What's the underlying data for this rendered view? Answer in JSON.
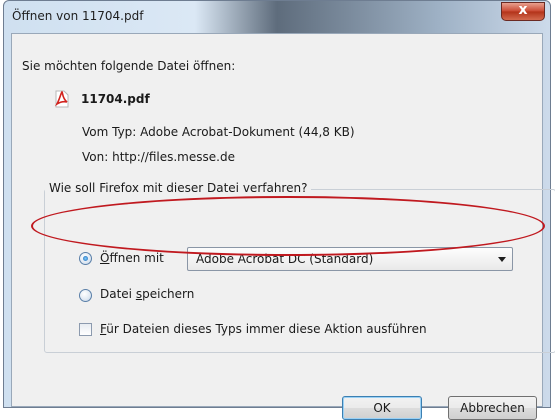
{
  "window": {
    "title": "Öffnen von 11704.pdf",
    "close_glyph": "x"
  },
  "dialog": {
    "intro": "Sie möchten folgende Datei öffnen:",
    "file_name": "11704.pdf",
    "file_icon": "pdf-file-icon",
    "type_line": "Vom Typ: Adobe Acrobat-Dokument (44,8 KB)",
    "from_line": "Von: http://files.messe.de",
    "group_legend": "Wie soll Firefox mit dieser Datei verfahren?",
    "open_with": {
      "label_underlined": "Ö",
      "label_rest": "ffnen mit",
      "selected": true
    },
    "app_select": {
      "value": "Adobe Acrobat DC  (Standard)"
    },
    "save_file": {
      "label_before": "Datei ",
      "label_underlined": "s",
      "label_after": "peichern",
      "selected": false
    },
    "always_do": {
      "label_underlined": "F",
      "label_rest": "ür Dateien dieses Typs immer diese Aktion ausführen",
      "checked": false
    },
    "ok_label": "OK",
    "cancel_label": "Abbrechen"
  },
  "colors": {
    "annotation_ring": "#c0191f",
    "close_button": "#c84630",
    "dialog_bg": "#f0f0f0"
  }
}
